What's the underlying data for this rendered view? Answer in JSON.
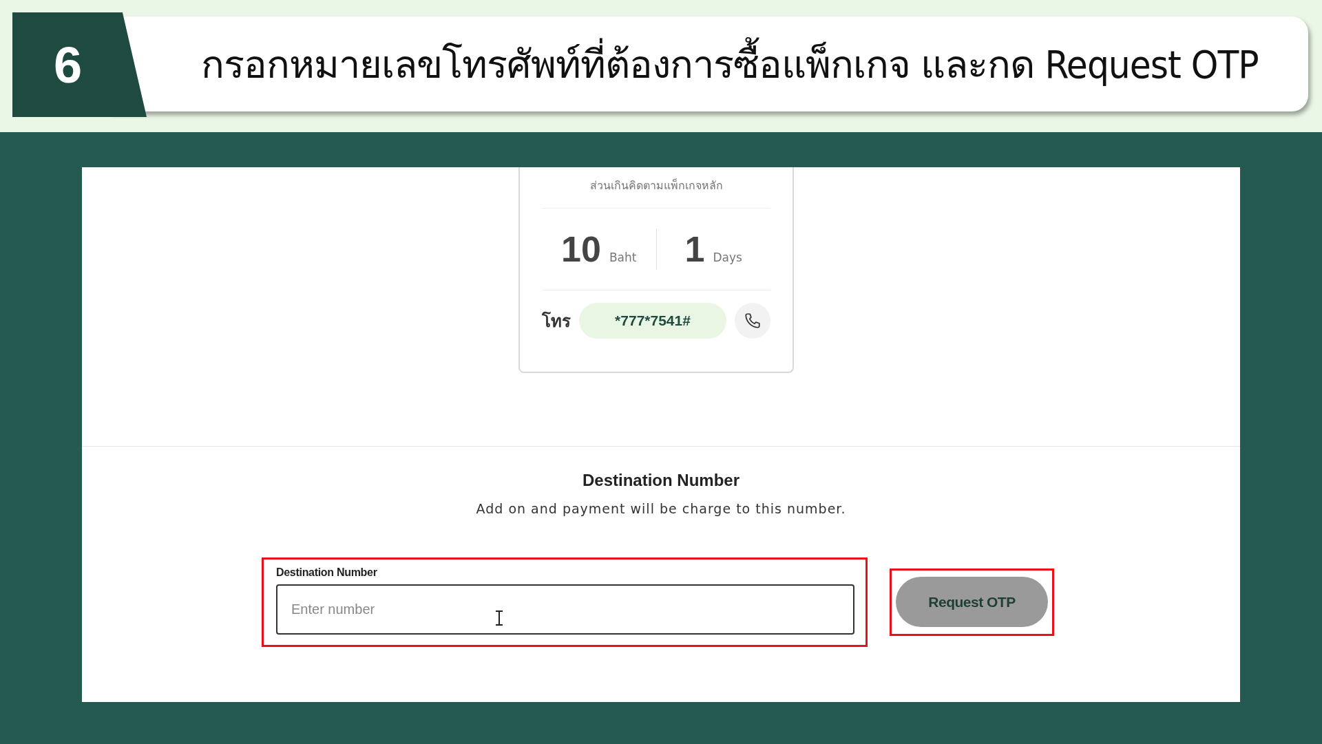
{
  "step": {
    "number": "6",
    "title": "กรอกหมายเลขโทรศัพท์ที่ต้องการซื้อแพ็กเกจ และกด Request OTP"
  },
  "package_card": {
    "note": "ส่วนเกินคิดตามแพ็กเกจหลัก",
    "stats": [
      {
        "value": "10",
        "unit": "Baht"
      },
      {
        "value": "1",
        "unit": "Days"
      }
    ],
    "call_label": "โทร",
    "dial_code": "*777*7541#"
  },
  "destination": {
    "heading": "Destination Number",
    "description": "Add on and payment will be charge to this number.",
    "field_label": "Destination Number",
    "placeholder": "Enter number",
    "button": "Request OTP"
  }
}
